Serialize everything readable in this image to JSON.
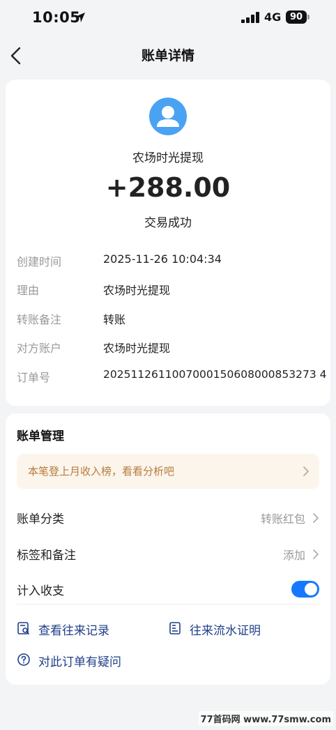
{
  "status_bar": {
    "time": "10:05",
    "network": "4G",
    "battery": "90"
  },
  "nav": {
    "title": "账单详情"
  },
  "detail": {
    "merchant": "农场时光提现",
    "amount": "+288.00",
    "status": "交易成功",
    "rows": [
      {
        "label": "创建时间",
        "value": "2025-11-26 10:04:34"
      },
      {
        "label": "理由",
        "value": "农场时光提现"
      },
      {
        "label": "转账备注",
        "value": "转账"
      },
      {
        "label": "对方账户",
        "value": "农场时光提现"
      },
      {
        "label": "订单号",
        "value": "2025112611007000150608000853273 4"
      }
    ]
  },
  "manage": {
    "title": "账单管理",
    "promo": "本笔登上月收入榜，看看分析吧",
    "category": {
      "label": "账单分类",
      "value": "转账红包"
    },
    "tags": {
      "label": "标签和备注",
      "value": "添加"
    },
    "count_in": {
      "label": "计入收支",
      "on": true
    },
    "links": {
      "records": "查看往来记录",
      "proof": "往来流水证明",
      "question": "对此订单有疑问"
    }
  },
  "watermark": "77首码网 www.77smw.com",
  "colors": {
    "accent": "#1677ff",
    "avatar": "#4aa3f2",
    "promo_text": "#b87b3c",
    "link": "#1f3f86"
  }
}
